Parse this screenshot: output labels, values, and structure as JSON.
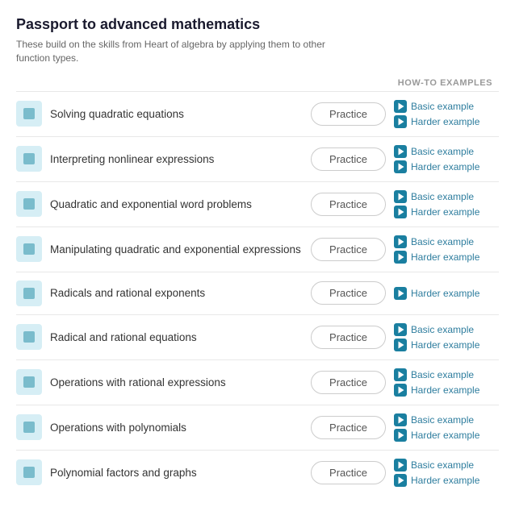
{
  "header": {
    "title": "Passport to advanced mathematics",
    "subtitle": "These build on the skills from Heart of algebra by applying them to other function types.",
    "column_label": "HOW-TO EXAMPLES"
  },
  "rows": [
    {
      "id": "solving-quadratic",
      "label": "Solving quadratic equations",
      "practice_label": "Practice",
      "examples": [
        "Basic example",
        "Harder example"
      ]
    },
    {
      "id": "interpreting-nonlinear",
      "label": "Interpreting nonlinear expressions",
      "practice_label": "Practice",
      "examples": [
        "Basic example",
        "Harder example"
      ]
    },
    {
      "id": "quadratic-exponential-word",
      "label": "Quadratic and exponential word problems",
      "practice_label": "Practice",
      "examples": [
        "Basic example",
        "Harder example"
      ]
    },
    {
      "id": "manipulating-quadratic",
      "label": "Manipulating quadratic and exponential expressions",
      "practice_label": "Practice",
      "examples": [
        "Basic example",
        "Harder example"
      ]
    },
    {
      "id": "radicals-rational-exponents",
      "label": "Radicals and rational exponents",
      "practice_label": "Practice",
      "examples": [
        "Harder example"
      ]
    },
    {
      "id": "radical-rational-equations",
      "label": "Radical and rational equations",
      "practice_label": "Practice",
      "examples": [
        "Basic example",
        "Harder example"
      ]
    },
    {
      "id": "operations-rational-expressions",
      "label": "Operations with rational expressions",
      "practice_label": "Practice",
      "examples": [
        "Basic example",
        "Harder example"
      ]
    },
    {
      "id": "operations-polynomials",
      "label": "Operations with polynomials",
      "practice_label": "Practice",
      "examples": [
        "Basic example",
        "Harder example"
      ]
    },
    {
      "id": "polynomial-factors-graphs",
      "label": "Polynomial factors and graphs",
      "practice_label": "Practice",
      "examples": [
        "Basic example",
        "Harder example"
      ]
    }
  ]
}
